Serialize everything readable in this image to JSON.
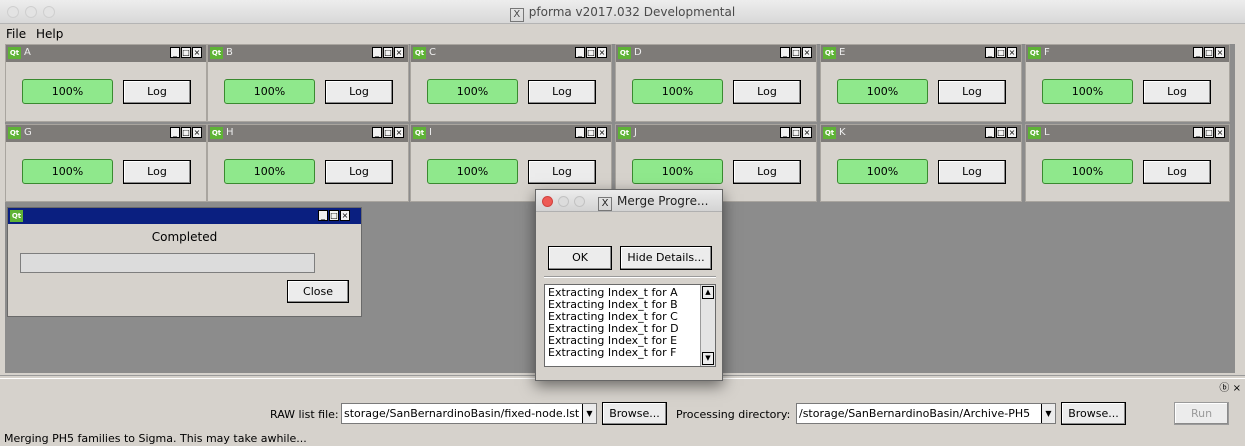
{
  "window": {
    "title": "pforma v2017.032 Developmental",
    "title_icon": "X"
  },
  "menu": {
    "file": "File",
    "help": "Help"
  },
  "subwindow_controls": [
    "_",
    "□",
    "×"
  ],
  "qt_badge": "Qt",
  "nodes": [
    {
      "name": "A",
      "progress": "100%",
      "log": "Log"
    },
    {
      "name": "B",
      "progress": "100%",
      "log": "Log"
    },
    {
      "name": "C",
      "progress": "100%",
      "log": "Log"
    },
    {
      "name": "D",
      "progress": "100%",
      "log": "Log"
    },
    {
      "name": "E",
      "progress": "100%",
      "log": "Log"
    },
    {
      "name": "F",
      "progress": "100%",
      "log": "Log"
    },
    {
      "name": "G",
      "progress": "100%",
      "log": "Log"
    },
    {
      "name": "H",
      "progress": "100%",
      "log": "Log"
    },
    {
      "name": "I",
      "progress": "100%",
      "log": "Log"
    },
    {
      "name": "J",
      "progress": "100%",
      "log": "Log"
    },
    {
      "name": "K",
      "progress": "100%",
      "log": "Log"
    },
    {
      "name": "L",
      "progress": "100%",
      "log": "Log"
    }
  ],
  "completed_dialog": {
    "message": "Completed",
    "close": "Close",
    "progress": 0
  },
  "merge_dialog": {
    "title": "Merge Progre...",
    "ok": "OK",
    "hide_details": "Hide Details...",
    "details": [
      "Extracting Index_t for A",
      "Extracting Index_t for B",
      "Extracting Index_t for C",
      "Extracting Index_t for D",
      "Extracting Index_t for E",
      "Extracting Index_t for F"
    ]
  },
  "bottom": {
    "raw_label": "RAW list file:",
    "raw_value": "storage/SanBernardinoBasin/fixed-node.lst",
    "browse": "Browse...",
    "proc_label": "Processing directory:",
    "proc_value": "/storage/SanBernardinoBasin/Archive-PH5",
    "run": "Run",
    "dock_icons": " ⓑ ×",
    "status": "Merging PH5 families to Sigma. This may take awhile..."
  },
  "colors": {
    "progress_green": "#8fe88c",
    "subwindow_title": "#7e7b78",
    "active_title": "#0a1f80"
  }
}
